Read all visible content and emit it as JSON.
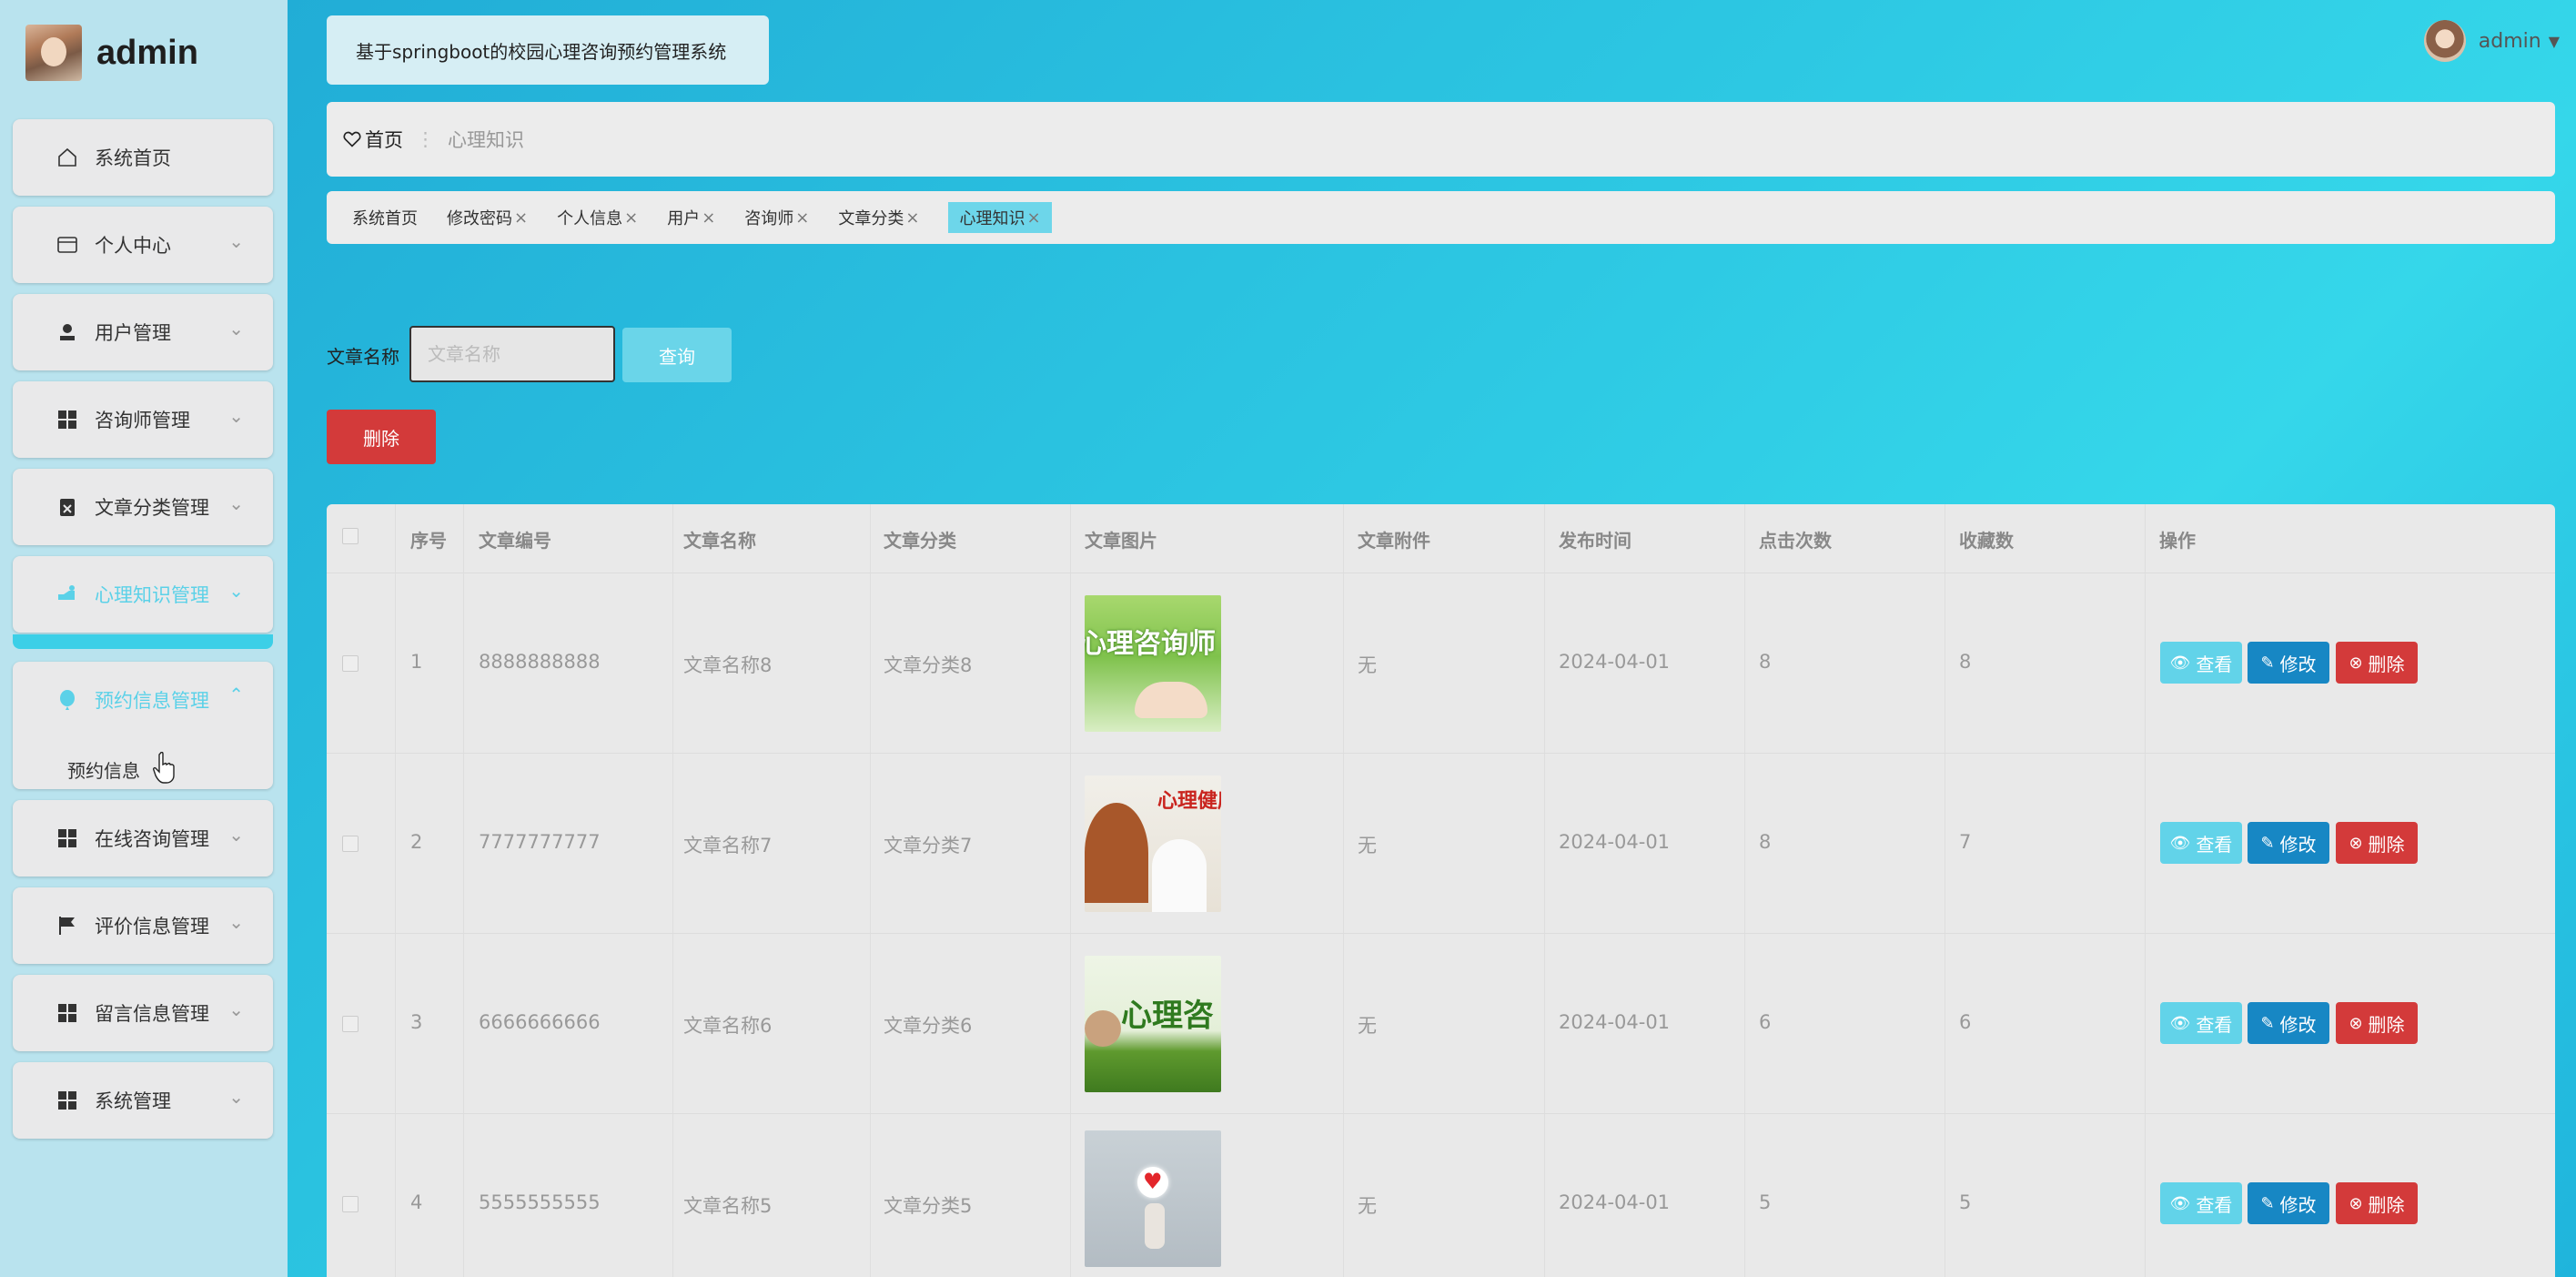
{
  "sidebar": {
    "brand_name": "admin",
    "menu": [
      {
        "label": "系统首页",
        "icon": "home-icon"
      },
      {
        "label": "个人中心",
        "icon": "id-card-icon"
      },
      {
        "label": "用户管理",
        "icon": "user-icon"
      },
      {
        "label": "咨询师管理",
        "icon": "grid-icon"
      },
      {
        "label": "文章分类管理",
        "icon": "clipboard-icon"
      },
      {
        "label": "心理知识管理",
        "icon": "hand-icon"
      },
      {
        "label": "预约信息管理",
        "icon": "balloon-icon"
      },
      {
        "label": "在线咨询管理",
        "icon": "grid-icon"
      },
      {
        "label": "评价信息管理",
        "icon": "flag-icon"
      },
      {
        "label": "留言信息管理",
        "icon": "grid-icon"
      },
      {
        "label": "系统管理",
        "icon": "grid-icon"
      }
    ],
    "submenu_item": "预约信息"
  },
  "header": {
    "system_title": "基于springboot的校园心理咨询预约管理系统",
    "user_name": "admin"
  },
  "breadcrumb": {
    "home": "首页",
    "current": "心理知识"
  },
  "tabs": [
    {
      "label": "系统首页",
      "closable": false
    },
    {
      "label": "修改密码",
      "closable": true
    },
    {
      "label": "个人信息",
      "closable": true
    },
    {
      "label": "用户",
      "closable": true
    },
    {
      "label": "咨询师",
      "closable": true
    },
    {
      "label": "文章分类",
      "closable": true
    },
    {
      "label": "心理知识",
      "closable": true,
      "active": true
    }
  ],
  "search": {
    "label": "文章名称",
    "placeholder": "文章名称",
    "button": "查询"
  },
  "batch_delete": "删除",
  "table": {
    "headers": [
      "序号",
      "文章编号",
      "文章名称",
      "文章分类",
      "文章图片",
      "文章附件",
      "发布时间",
      "点击次数",
      "收藏数",
      "操作"
    ],
    "actions": {
      "view": "查看",
      "edit": "修改",
      "delete": "删除"
    },
    "rows": [
      {
        "index": "1",
        "number": "8888888888",
        "name": "文章名称8",
        "category": "文章分类8",
        "image_caption": "心理咨询师",
        "attachment": "无",
        "date": "2024-04-01",
        "clicks": "8",
        "favorites": "8"
      },
      {
        "index": "2",
        "number": "7777777777",
        "name": "文章名称7",
        "category": "文章分类7",
        "image_caption": "心理健康",
        "attachment": "无",
        "date": "2024-04-01",
        "clicks": "8",
        "favorites": "7"
      },
      {
        "index": "3",
        "number": "6666666666",
        "name": "文章名称6",
        "category": "文章分类6",
        "image_caption": "心理咨",
        "attachment": "无",
        "date": "2024-04-01",
        "clicks": "6",
        "favorites": "6"
      },
      {
        "index": "4",
        "number": "5555555555",
        "name": "文章名称5",
        "category": "文章分类5",
        "image_caption": "",
        "attachment": "无",
        "date": "2024-04-01",
        "clicks": "5",
        "favorites": "5"
      }
    ]
  },
  "colors": {
    "accent": "#3ccfe7",
    "danger": "#d33a3a",
    "edit": "#1787c4"
  }
}
